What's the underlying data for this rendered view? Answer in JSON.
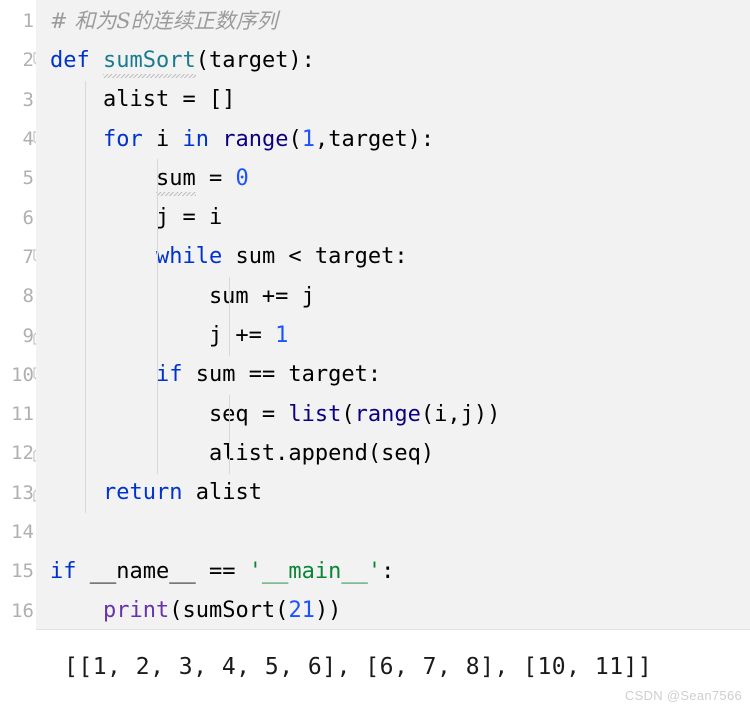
{
  "editor": {
    "language": "python",
    "colors": {
      "gutter_bg": "#ffffff",
      "code_bg": "#f2f2f2",
      "linenum": "#b0b0b0",
      "keyword": "#0033cc",
      "builtin": "#0b0080",
      "function_def": "#1a7b8f",
      "number": "#1a53ff",
      "string": "#0a8536",
      "print_builtin": "#6633aa",
      "comment": "#9b9b9b",
      "indent_guide": "#d8d8d8"
    },
    "lines": [
      {
        "num": "1",
        "fold": "none",
        "indent": 0,
        "tokens": [
          {
            "text": "# 和为S的连续正数序列",
            "type": "comment"
          }
        ]
      },
      {
        "num": "2",
        "fold": "start",
        "indent": 0,
        "tokens": [
          {
            "text": "def",
            "type": "kw"
          },
          {
            "text": " ",
            "type": "plain"
          },
          {
            "text": "sumSort",
            "type": "func",
            "squiggle": true
          },
          {
            "text": "(target):",
            "type": "plain"
          }
        ]
      },
      {
        "num": "3",
        "fold": "none",
        "indent": 1,
        "tokens": [
          {
            "text": "    alist = []",
            "type": "plain"
          }
        ]
      },
      {
        "num": "4",
        "fold": "start",
        "indent": 1,
        "tokens": [
          {
            "text": "    ",
            "type": "plain"
          },
          {
            "text": "for",
            "type": "kw"
          },
          {
            "text": " i ",
            "type": "plain"
          },
          {
            "text": "in",
            "type": "kw"
          },
          {
            "text": " ",
            "type": "plain"
          },
          {
            "text": "range",
            "type": "builtin"
          },
          {
            "text": "(",
            "type": "plain"
          },
          {
            "text": "1",
            "type": "num"
          },
          {
            "text": ",target):",
            "type": "plain"
          }
        ]
      },
      {
        "num": "5",
        "fold": "none",
        "indent": 2,
        "tokens": [
          {
            "text": "        ",
            "type": "plain"
          },
          {
            "text": "sum",
            "type": "plain",
            "squiggle": true
          },
          {
            "text": " = ",
            "type": "plain"
          },
          {
            "text": "0",
            "type": "num"
          }
        ]
      },
      {
        "num": "6",
        "fold": "none",
        "indent": 2,
        "tokens": [
          {
            "text": "        j = i",
            "type": "plain"
          }
        ]
      },
      {
        "num": "7",
        "fold": "start",
        "indent": 2,
        "tokens": [
          {
            "text": "        ",
            "type": "plain"
          },
          {
            "text": "while",
            "type": "kw"
          },
          {
            "text": " sum < target:",
            "type": "plain"
          }
        ]
      },
      {
        "num": "8",
        "fold": "none",
        "indent": 3,
        "tokens": [
          {
            "text": "            sum += j",
            "type": "plain"
          }
        ]
      },
      {
        "num": "9",
        "fold": "end",
        "indent": 3,
        "tokens": [
          {
            "text": "            j += ",
            "type": "plain"
          },
          {
            "text": "1",
            "type": "num"
          }
        ]
      },
      {
        "num": "10",
        "fold": "start",
        "indent": 2,
        "tokens": [
          {
            "text": "        ",
            "type": "plain"
          },
          {
            "text": "if",
            "type": "kw"
          },
          {
            "text": " sum == target:",
            "type": "plain"
          }
        ]
      },
      {
        "num": "11",
        "fold": "none",
        "indent": 3,
        "tokens": [
          {
            "text": "            seq = ",
            "type": "plain"
          },
          {
            "text": "list",
            "type": "builtin"
          },
          {
            "text": "(",
            "type": "plain"
          },
          {
            "text": "range",
            "type": "builtin"
          },
          {
            "text": "(i,j))",
            "type": "plain"
          }
        ]
      },
      {
        "num": "12",
        "fold": "end",
        "indent": 3,
        "tokens": [
          {
            "text": "            alist.append(seq)",
            "type": "plain"
          }
        ]
      },
      {
        "num": "13",
        "fold": "end",
        "indent": 1,
        "tokens": [
          {
            "text": "    ",
            "type": "plain"
          },
          {
            "text": "return",
            "type": "kw"
          },
          {
            "text": " alist",
            "type": "plain"
          }
        ]
      },
      {
        "num": "14",
        "fold": "none",
        "indent": 0,
        "tokens": []
      },
      {
        "num": "15",
        "fold": "none",
        "indent": 0,
        "tokens": [
          {
            "text": "if",
            "type": "kw"
          },
          {
            "text": " __name__ == ",
            "type": "plain"
          },
          {
            "text": "'__main__'",
            "type": "str"
          },
          {
            "text": ":",
            "type": "plain"
          }
        ]
      },
      {
        "num": "16",
        "fold": "none",
        "indent": 1,
        "tokens": [
          {
            "text": "    ",
            "type": "plain"
          },
          {
            "text": "print",
            "type": "print"
          },
          {
            "text": "(sumSort(",
            "type": "plain"
          },
          {
            "text": "21",
            "type": "num"
          },
          {
            "text": "))",
            "type": "plain"
          }
        ]
      }
    ]
  },
  "output": {
    "text": "[[1, 2, 3, 4, 5, 6], [6, 7, 8], [10, 11]]"
  },
  "watermark": {
    "text": "CSDN @Sean7566"
  }
}
